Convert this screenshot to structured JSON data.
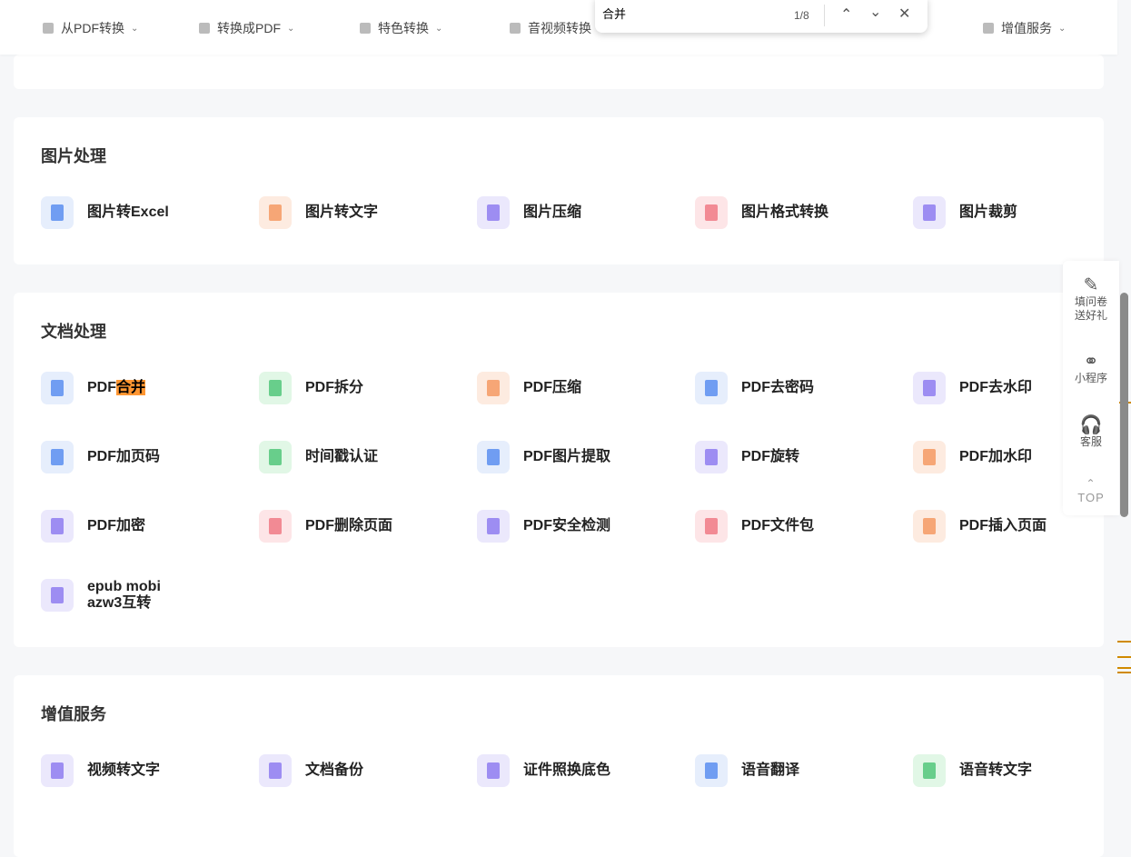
{
  "nav": [
    {
      "label": "从PDF转换",
      "chev": true
    },
    {
      "label": "转换成PDF",
      "chev": true
    },
    {
      "label": "特色转换",
      "chev": true
    },
    {
      "label": "音视频转换",
      "chev": false
    },
    {
      "label": "增值服务",
      "chev": true
    }
  ],
  "find": {
    "query": "合并",
    "count": "1/8"
  },
  "sections": [
    {
      "title": "图片处理",
      "items": [
        {
          "label": "图片转Excel",
          "bg": "#e6eefc",
          "color": "#5b8ef0"
        },
        {
          "label": "图片转文字",
          "bg": "#fdebe0",
          "color": "#f59a63"
        },
        {
          "label": "图片压缩",
          "bg": "#ebe8fc",
          "color": "#8f7cf0"
        },
        {
          "label": "图片格式转换",
          "bg": "#fde5e7",
          "color": "#f07a85"
        },
        {
          "label": "图片裁剪",
          "bg": "#ebe8fc",
          "color": "#8f7cf0"
        }
      ]
    },
    {
      "title": "文档处理",
      "items": [
        {
          "label": "PDF",
          "highlight": "合并",
          "bg": "#e6eefc",
          "color": "#5b8ef0"
        },
        {
          "label": "PDF拆分",
          "bg": "#e1f7e6",
          "color": "#52c77a"
        },
        {
          "label": "PDF压缩",
          "bg": "#fdebe0",
          "color": "#f59a63"
        },
        {
          "label": "PDF去密码",
          "bg": "#e6eefc",
          "color": "#5b8ef0"
        },
        {
          "label": "PDF去水印",
          "bg": "#ebe8fc",
          "color": "#8f7cf0"
        },
        {
          "label": "PDF加页码",
          "bg": "#e6eefc",
          "color": "#5b8ef0"
        },
        {
          "label": "时间戳认证",
          "bg": "#e1f7e6",
          "color": "#52c77a"
        },
        {
          "label": "PDF图片提取",
          "bg": "#e6eefc",
          "color": "#5b8ef0"
        },
        {
          "label": "PDF旋转",
          "bg": "#ebe8fc",
          "color": "#8f7cf0"
        },
        {
          "label": "PDF加水印",
          "bg": "#fdebe0",
          "color": "#f59a63"
        },
        {
          "label": "PDF加密",
          "bg": "#ebe8fc",
          "color": "#8f7cf0"
        },
        {
          "label": "PDF删除页面",
          "bg": "#fde5e7",
          "color": "#f07a85"
        },
        {
          "label": "PDF安全检测",
          "bg": "#ebe8fc",
          "color": "#8f7cf0"
        },
        {
          "label": "PDF文件包",
          "bg": "#fde5e7",
          "color": "#f07a85"
        },
        {
          "label": "PDF插入页面",
          "bg": "#fdebe0",
          "color": "#f59a63"
        },
        {
          "label": "epub mobi\nazw3互转",
          "bg": "#ebe8fc",
          "color": "#8f7cf0"
        }
      ]
    },
    {
      "title": "增值服务",
      "items": [
        {
          "label": "视频转文字",
          "bg": "#ebe8fc",
          "color": "#8f7cf0"
        },
        {
          "label": "文档备份",
          "bg": "#ebe8fc",
          "color": "#8f7cf0"
        },
        {
          "label": "证件照换底色",
          "bg": "#ebe8fc",
          "color": "#8f7cf0"
        },
        {
          "label": "语音翻译",
          "bg": "#e6eefc",
          "color": "#5b8ef0"
        },
        {
          "label": "语音转文字",
          "bg": "#e1f7e6",
          "color": "#52c77a"
        }
      ]
    }
  ],
  "side": {
    "survey": "填问卷\n送好礼",
    "mini": "小程序",
    "service": "客服",
    "top": "TOP"
  }
}
